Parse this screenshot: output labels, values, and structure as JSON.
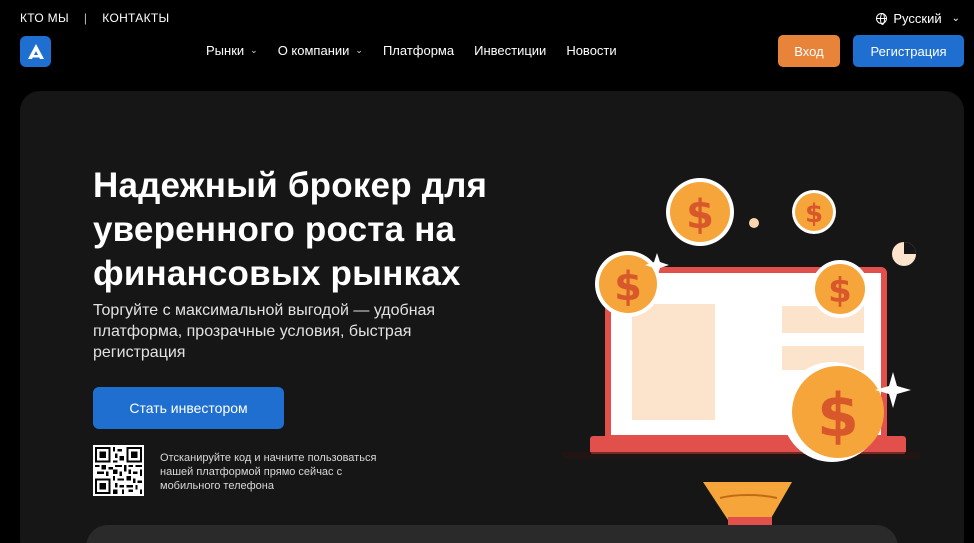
{
  "topbar": {
    "links": [
      "КТО МЫ",
      "КОНТАКТЫ"
    ],
    "language": "Русский"
  },
  "nav": {
    "items": [
      {
        "label": "Рынки",
        "dropdown": true
      },
      {
        "label": "О компании",
        "dropdown": true
      },
      {
        "label": "Платформа",
        "dropdown": false
      },
      {
        "label": "Инвестиции",
        "dropdown": false
      },
      {
        "label": "Новости",
        "dropdown": false
      }
    ],
    "login_label": "Вход",
    "register_label": "Регистрация"
  },
  "hero": {
    "headline_lines": [
      "Надежный брокер для",
      "уверенного роста на",
      "финансовых рынках"
    ],
    "subline_lines": [
      "Торгуйте с максимальной выгодой — удобная",
      "платформа, прозрачные условия, быстрая",
      "регистрация"
    ],
    "cta_label": "Стать инвестором",
    "qr_text_lines": [
      "Отсканируйте код и начните пользоваться",
      "нашей платформой прямо сейчас с",
      "мобильного телефона"
    ]
  },
  "colors": {
    "accent_blue": "#1f6fd1",
    "accent_orange": "#e8833a",
    "coin": "#f5a53a",
    "laptop": "#e2504b"
  },
  "icons": [
    "logo-icon",
    "globe-icon",
    "chevron-down-icon",
    "qr-code",
    "coin-icon",
    "pie-chart-icon",
    "sparkle-icon"
  ]
}
